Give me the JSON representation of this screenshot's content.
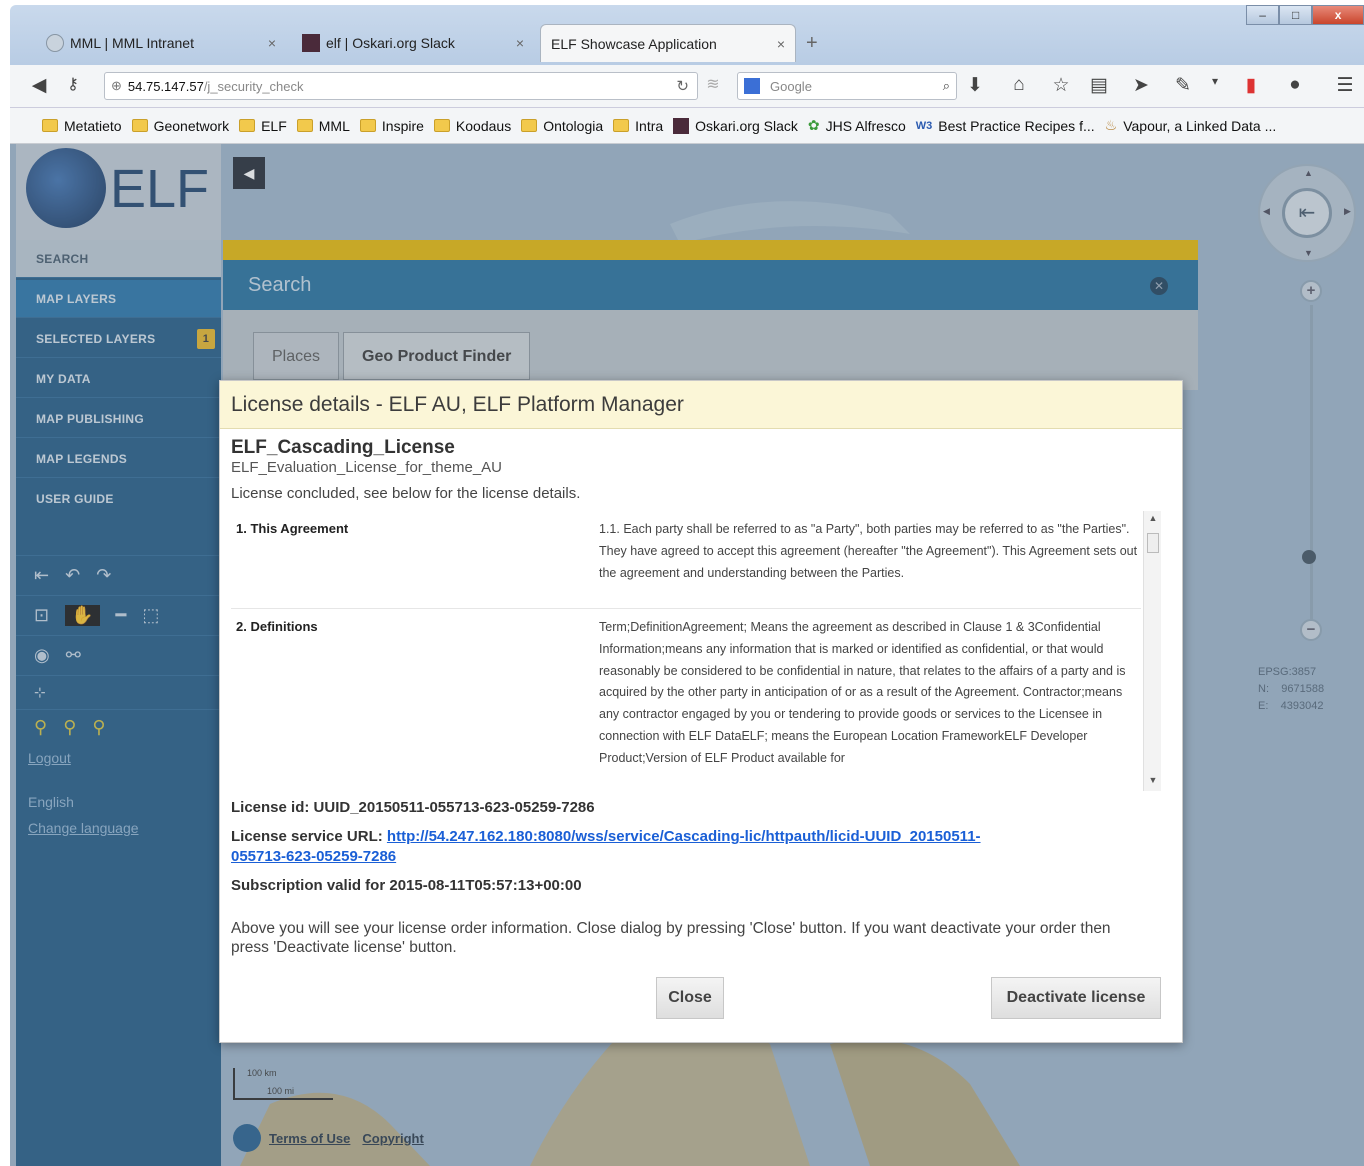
{
  "browser": {
    "window_controls": {
      "min": "–",
      "max": "□",
      "close": "x"
    },
    "tabs": [
      {
        "label": "MML | MML Intranet",
        "close": "×"
      },
      {
        "label": "elf | Oskari.org Slack",
        "close": "×"
      },
      {
        "label": "ELF Showcase Application",
        "close": "×"
      }
    ],
    "new_tab": "+",
    "url_host": "54.75.147.57",
    "url_path": "/j_security_check",
    "search_placeholder": "Google",
    "bookmarks": [
      "Metatieto",
      "Geonetwork",
      "ELF",
      "MML",
      "Inspire",
      "Koodaus",
      "Ontologia",
      "Intra",
      "Oskari.org Slack",
      "JHS Alfresco",
      "Best Practice Recipes f...",
      "Vapour, a Linked Data ..."
    ]
  },
  "app": {
    "logo_text": "ELF",
    "sidebar": {
      "items": [
        {
          "label": "SEARCH"
        },
        {
          "label": "MAP LAYERS"
        },
        {
          "label": "SELECTED LAYERS",
          "badge": "1"
        },
        {
          "label": "MY DATA"
        },
        {
          "label": "MAP PUBLISHING"
        },
        {
          "label": "MAP LEGENDS"
        },
        {
          "label": "USER GUIDE"
        }
      ],
      "logout": "Logout",
      "language": "English",
      "change_language": "Change language"
    },
    "search_panel": {
      "title": "Search",
      "tabs": [
        "Places",
        "Geo Product Finder"
      ]
    },
    "map": {
      "coords": {
        "epsg": "EPSG:3857",
        "n_label": "N:",
        "n_value": "9671588",
        "e_label": "E:",
        "e_value": "4393042"
      },
      "scale_km": "100 km",
      "scale_mi": "100 mi",
      "terms_link": "Terms of Use",
      "copyright_link": "Copyright"
    }
  },
  "dialog": {
    "title": "License details - ELF AU, ELF Platform Manager",
    "license_name": "ELF_Cascading_License",
    "license_subtitle": "ELF_Evaluation_License_for_theme_AU",
    "status": "License concluded, see below for the license details.",
    "terms": [
      {
        "key": "1. This Agreement",
        "value": "1.1. Each party shall be referred to as \"a Party\", both parties may be referred to as \"the Parties\". They have agreed to accept this agreement (hereafter \"the Agreement\"). This Agreement sets out the agreement and understanding between the Parties."
      },
      {
        "key": "2. Definitions",
        "value": "Term;DefinitionAgreement; Means the agreement as described in Clause 1 & 3Confidential Information;means any information that is marked or identified as confidential, or that would reasonably be considered to be confidential in nature, that relates to the affairs of a party and is acquired by the other party in anticipation of or as a result of the Agreement. Contractor;means any contractor engaged by you or tendering to provide goods or services to the Licensee in connection with ELF DataELF; means the European Location FrameworkELF Developer Product;Version of ELF Product available for"
      }
    ],
    "license_id_label": "License id:",
    "license_id": "UUID_20150511-055713-623-05259-7286",
    "service_url_label": "License service URL:",
    "service_url": "http://54.247.162.180:8080/wss/service/Cascading-lic/httpauth/licid-UUID_20150511-055713-623-05259-7286",
    "subscription": "Subscription valid for 2015-08-11T05:57:13+00:00",
    "info": "Above you will see your license order information. Close dialog by pressing 'Close' button. If you want deactivate your order then press 'Deactivate license' button.",
    "close_label": "Close",
    "deactivate_label": "Deactivate license"
  }
}
